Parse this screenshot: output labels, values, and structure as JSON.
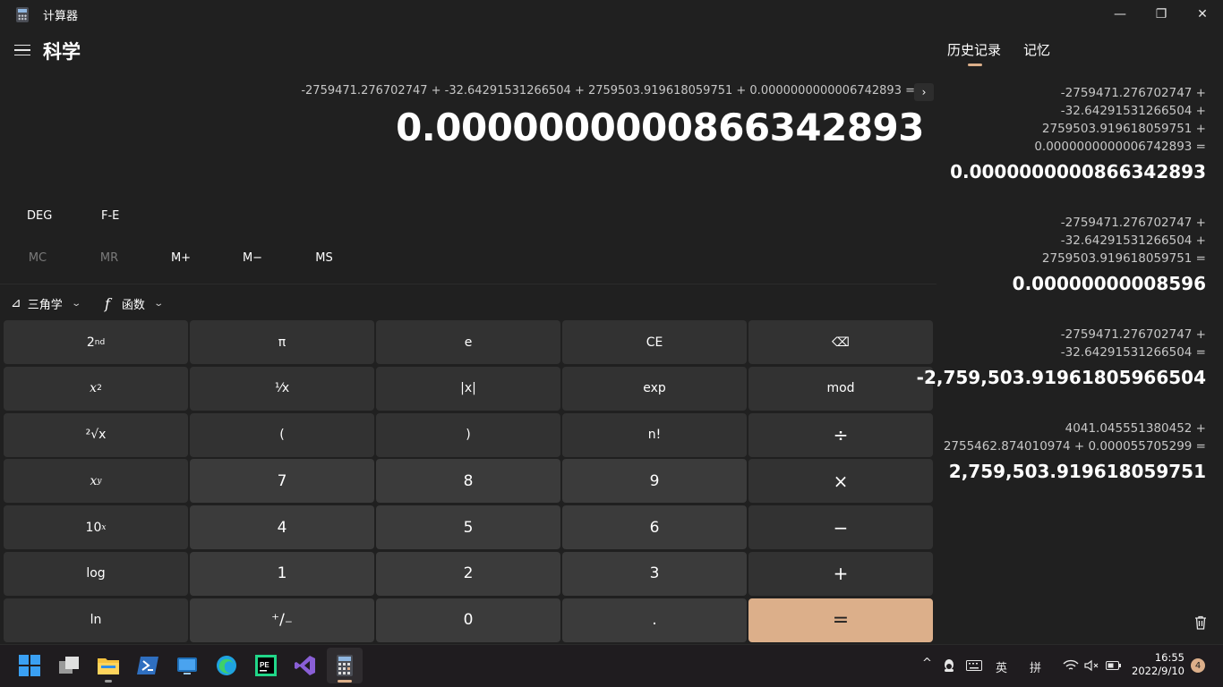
{
  "window": {
    "title": "计算器",
    "controls": {
      "minimize": "—",
      "restore": "❐",
      "close": "✕"
    }
  },
  "header": {
    "mode_title": "科学"
  },
  "display": {
    "expression": "-2759471.276702747 + -32.64291531266504 + 2759503.919618059751 + 0.0000000000006742893 =",
    "expression_arrow": "›",
    "result": "0.0000000000866342893"
  },
  "mode_row": {
    "angle": "DEG",
    "fe": "F-E"
  },
  "memory": {
    "mc": "MC",
    "mr": "MR",
    "m_plus": "M+",
    "m_minus": "M−",
    "ms": "MS"
  },
  "dropdowns": {
    "trig": {
      "icon": "⊿",
      "label": "三角学",
      "chevron": "⌄"
    },
    "func": {
      "icon": "f",
      "label": "函数",
      "chevron": "⌄"
    }
  },
  "keypad": {
    "second": "2",
    "second_sup": "nd",
    "pi": "π",
    "e": "e",
    "ce": "CE",
    "backspace": "⌫",
    "square": "x",
    "square_sup": "2",
    "reciprocal": "⅟x",
    "abs": "|x|",
    "exp": "exp",
    "mod": "mod",
    "sqrt": "²√x",
    "lparen": "(",
    "rparen": ")",
    "factorial": "n!",
    "divide": "÷",
    "pow": "x",
    "pow_sup": "y",
    "n7": "7",
    "n8": "8",
    "n9": "9",
    "multiply": "×",
    "tenpow": "10",
    "tenpow_sup": "x",
    "n4": "4",
    "n5": "5",
    "n6": "6",
    "minus": "−",
    "log": "log",
    "n1": "1",
    "n2": "2",
    "n3": "3",
    "plus": "+",
    "ln": "ln",
    "negate": "⁺∕₋",
    "n0": "0",
    "decimal": ".",
    "equals": "="
  },
  "history_panel": {
    "tab_history": "历史记录",
    "tab_memory": "记忆",
    "items": [
      {
        "lines": [
          "-2759471.276702747   +",
          "-32.64291531266504   +",
          "2759503.919618059751   +",
          "0.0000000000006742893 ="
        ],
        "result": "0.0000000000866342893"
      },
      {
        "lines": [
          "-2759471.276702747   +",
          "-32.64291531266504   +",
          "2759503.919618059751 ="
        ],
        "result": "0.00000000008596"
      },
      {
        "lines": [
          "-2759471.276702747   +",
          "-32.64291531266504 ="
        ],
        "result": "-2,759,503.91961805966504"
      },
      {
        "lines": [
          "4041.045551380452   +",
          "2755462.874010974   +   0.000055705299 ="
        ],
        "result": "2,759,503.919618059751"
      }
    ]
  },
  "taskbar": {
    "tray": {
      "chevron": "^",
      "ime_lang": "英",
      "ime_mode": "拼"
    },
    "clock_time": "16:55",
    "clock_date": "2022/9/10",
    "notifications": "4"
  },
  "colors": {
    "accent": "#dcaf8a",
    "background": "#202020",
    "key": "#323232",
    "key_number": "#3b3b3b"
  }
}
